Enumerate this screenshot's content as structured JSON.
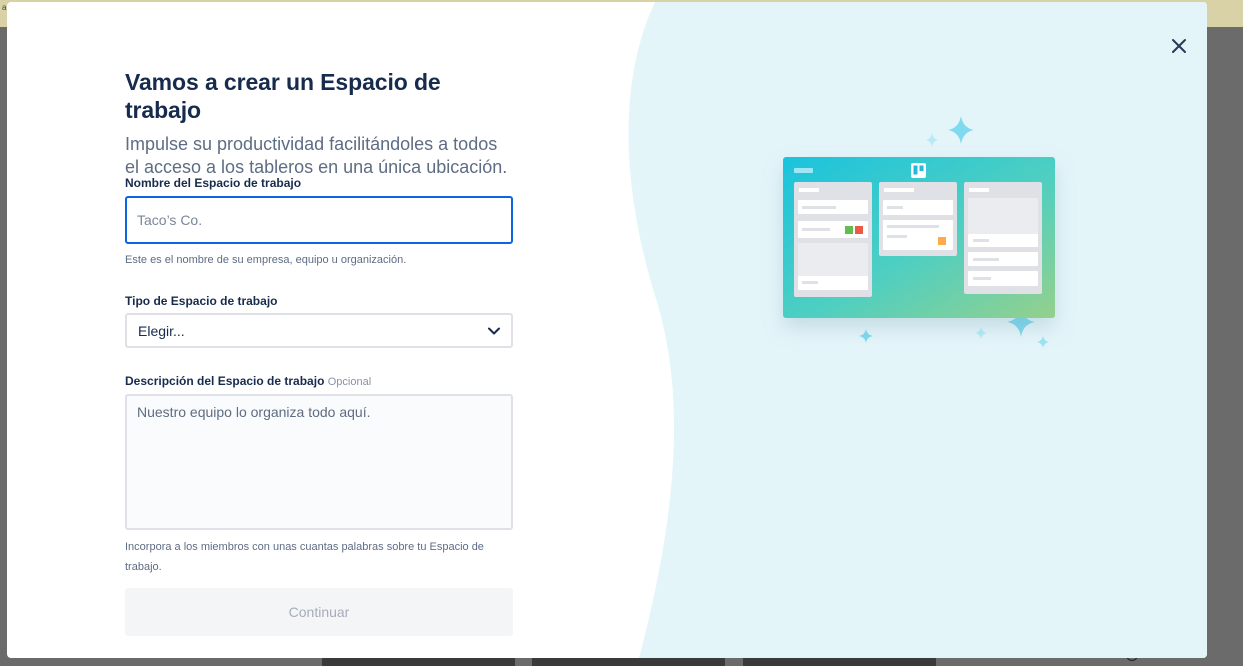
{
  "form": {
    "title": "Vamos a crear un Espacio de trabajo",
    "subtitle": "Impulse su productividad facilitándoles a todos el acceso a los tableros en una única ubicación.",
    "name_field": {
      "label": "Nombre del Espacio de trabajo",
      "placeholder": "Taco’s Co.",
      "value": "",
      "help": "Este es el nombre de su empresa, equipo u organización."
    },
    "type_field": {
      "label": "Tipo de Espacio de trabajo",
      "selected": "Elegir..."
    },
    "description_field": {
      "label": "Descripción del Espacio de trabajo",
      "optional_tag": "Opcional",
      "placeholder": "Nuestro equipo lo organiza todo aquí.",
      "help": "Incorpora a los miembros con unas cuantas palabras sobre tu Espacio de trabajo."
    },
    "continue_label": "Continuar"
  },
  "icons": {
    "close": "close-icon",
    "chevron": "chevron-down-icon",
    "board_logo": "board-logo-icon",
    "sparkle": "sparkle-icon"
  },
  "colors": {
    "focus_border": "#0c66e4",
    "panel_bg": "#e4f5fa",
    "board_gradient_start": "#1bc3dd",
    "board_gradient_end": "#94d08c",
    "sparkle": "#9ce2f3",
    "label_green": "#61bd4f",
    "label_red": "#eb5a46",
    "label_orange": "#ffab4a"
  }
}
